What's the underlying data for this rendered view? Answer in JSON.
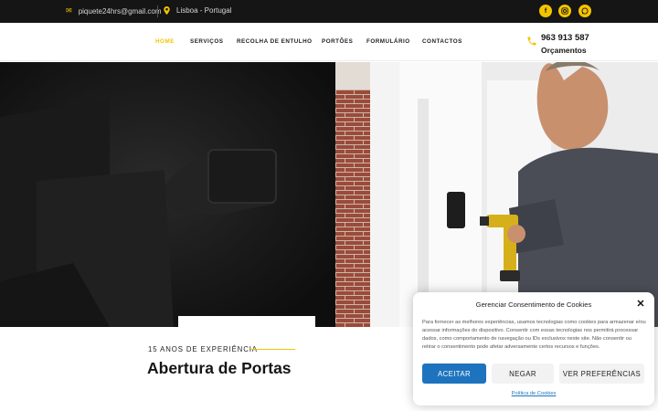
{
  "topbar": {
    "email": "piquete24hrs@gmail.com",
    "email_icon": "envelope-icon",
    "location": "Lisboa - Portugal",
    "location_icon": "map-pin-icon",
    "social": [
      {
        "icon": "facebook-icon",
        "glyph": "f"
      },
      {
        "icon": "instagram-icon",
        "glyph": "◎"
      },
      {
        "icon": "whatsapp-icon",
        "glyph": "✆"
      }
    ]
  },
  "nav": {
    "items": [
      "HOME",
      "SERVIÇOS",
      "RECOLHA DE ENTULHO",
      "PORTÕES",
      "FORMULÁRIO",
      "CONTACTOS"
    ],
    "active": "HOME"
  },
  "contact": {
    "phone": "963 913 587",
    "subtitle": "Orçamentos",
    "phone_icon": "phone-icon"
  },
  "hero": {
    "eyebrow": "15 ANOS DE EXPERIÊNCIA",
    "title": "Abertura de Portas"
  },
  "cookie": {
    "title": "Gerenciar Consentimento de Cookies",
    "text": "Para fornecer as melhores experiências, usamos tecnologias como cookies para armazenar e/ou acessar informações do dispositivo. Consentir com essas tecnologias nos permitirá processar dados, como comportamento de navegação ou IDs exclusivos neste site. Não consentir ou retirar o consentimento pode afetar adversamente certos recursos e funções.",
    "accept": "ACEITAR",
    "deny": "NEGAR",
    "preferences": "VER PREFERÊNCIAS",
    "policy": "Política de Cookies"
  },
  "colors": {
    "accent": "#f5c400",
    "topbar_bg": "#151515",
    "button_blue": "#1e73be"
  }
}
